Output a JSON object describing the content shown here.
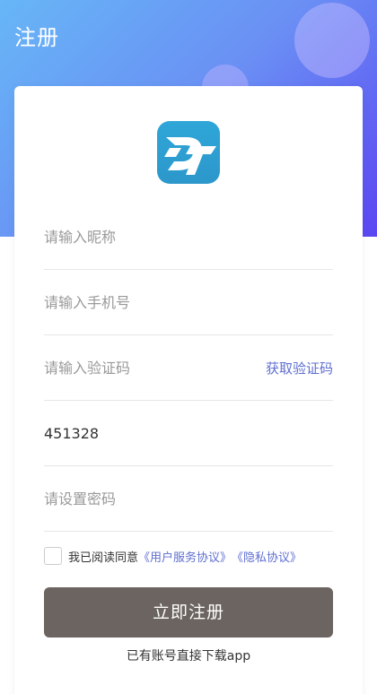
{
  "header": {
    "title": "注册"
  },
  "form": {
    "nickname_placeholder": "请输入昵称",
    "phone_placeholder": "请输入手机号",
    "code_placeholder": "请输入验证码",
    "get_code_label": "获取验证码",
    "image_code_value": "451328",
    "password_placeholder": "请设置密码"
  },
  "agreement": {
    "prefix": "我已阅读同意",
    "user_service_link": "《用户服务协议》",
    "privacy_link": "《隐私协议》",
    "checked": false
  },
  "actions": {
    "register_label": "立即注册",
    "download_text": "已有账号直接下载app"
  },
  "colors": {
    "accent_link": "#5f6fd0",
    "button_bg": "#6b6460",
    "gradient_start": "#67b6f7",
    "gradient_end": "#5b46f2",
    "logo_bg": "#2fa6d8"
  },
  "icons": {
    "logo": "app-logo-icon"
  }
}
